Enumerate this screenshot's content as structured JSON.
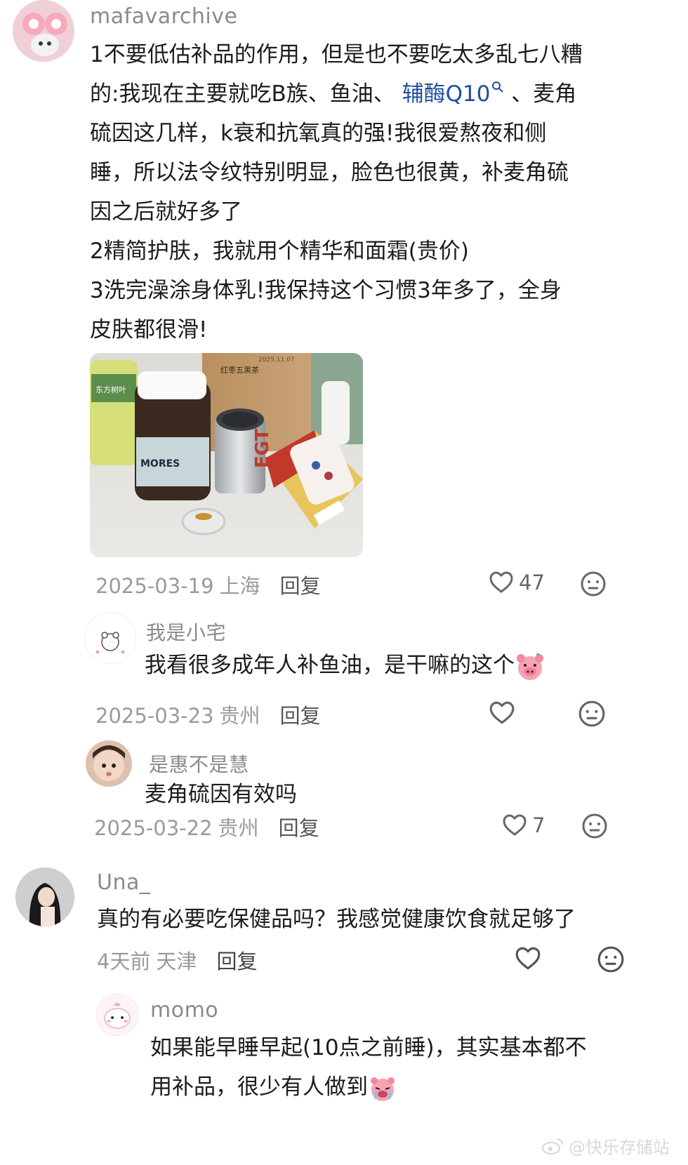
{
  "comments": [
    {
      "username": "mafavarchive",
      "lines": [
        "1不要低估补品的作用，但是也不要吃太多乱七八糟",
        "的:我现在主要就吃B族、鱼油、",
        "硫因这几样，k衰和抗氧真的强!我很爱熬夜和侧",
        "睡，所以法令纹特别明显，脸色也很黄，补麦角硫",
        "因之后就好多了",
        "2精简护肤，我就用个精华和面霜(贵价)",
        "3洗完澡涂身体乳!我保持这个习惯3年多了，全身",
        "皮肤都很滑!"
      ],
      "link_text": "辅酶Q10",
      "line2_tail": "、麦角",
      "date": "2025-03-19",
      "location": "上海",
      "reply_label": "回复",
      "likes": "47",
      "photo_labels": {
        "bottle_a": "东方树叶",
        "bottle_b": "MORES",
        "can": "EGT",
        "bag": "红枣五黑茶",
        "bag_date": "2025.11.07"
      }
    },
    {
      "username": "我是小宅",
      "text": "我看很多成年人补鱼油，是干嘛的这个",
      "date": "2025-03-23",
      "location": "贵州",
      "reply_label": "回复",
      "likes": ""
    },
    {
      "username": "是惠不是慧",
      "text": "麦角硫因有效吗",
      "date": "2025-03-22",
      "location": "贵州",
      "reply_label": "回复",
      "likes": "7"
    },
    {
      "username": "Una_",
      "text": "真的有必要吃保健品吗？我感觉健康饮食就足够了",
      "date": "4天前",
      "location": "天津",
      "reply_label": "回复",
      "likes": ""
    },
    {
      "username": "momo",
      "lines": [
        "如果能早睡早起(10点之前睡)，其实基本都不",
        "用补品，很少有人做到"
      ]
    }
  ],
  "watermark": "@快乐存储站",
  "icons": {
    "like": "heart-outline-icon",
    "dislike": "neutral-face-icon",
    "search": "search-icon"
  },
  "colors": {
    "link": "#1f4e9c",
    "meta": "#9a9a9a",
    "username": "#8a8a8a"
  }
}
